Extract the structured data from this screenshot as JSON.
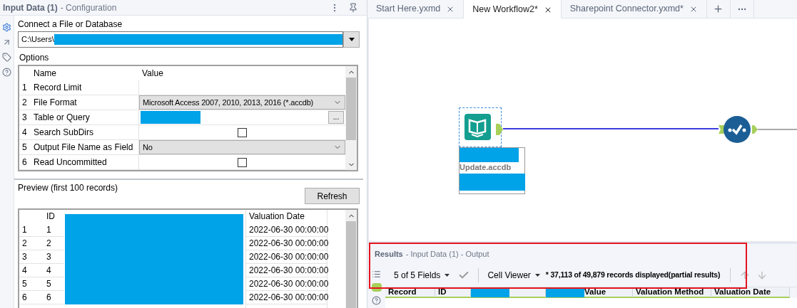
{
  "config_panel": {
    "title": "Input Data (1)",
    "subtitle": "- Configuration",
    "connect_label": "Connect a File or Database",
    "path_value": "C:\\Users\\",
    "options_label": "Options"
  },
  "options_table": {
    "columns": [
      "Name",
      "Value"
    ],
    "rows": [
      {
        "num": "1",
        "name": "Record Limit",
        "kind": "text"
      },
      {
        "num": "2",
        "name": "File Format",
        "kind": "dropdown",
        "value": "Microsoft Access 2007, 2010, 2013, 2016 (*.accdb)"
      },
      {
        "num": "3",
        "name": "Table or Query",
        "kind": "browse",
        "browse_label": "..."
      },
      {
        "num": "4",
        "name": "Search SubDirs",
        "kind": "checkbox",
        "checked": false
      },
      {
        "num": "5",
        "name": "Output File Name as Field",
        "kind": "dropdown",
        "value": "No"
      },
      {
        "num": "6",
        "name": "Read Uncommitted",
        "kind": "checkbox",
        "checked": false
      }
    ]
  },
  "preview": {
    "label": "Preview (first 100 records)",
    "refresh_button": "Refresh",
    "columns": [
      "ID",
      "Valuation Date"
    ],
    "rows": [
      {
        "num": "1",
        "id": "1",
        "date": "2022-06-30 00:00:00"
      },
      {
        "num": "2",
        "id": "2",
        "date": "2022-06-30 00:00:00"
      },
      {
        "num": "3",
        "id": "3",
        "date": "2022-06-30 00:00:00"
      },
      {
        "num": "4",
        "id": "4",
        "date": "2022-06-30 00:00:00"
      },
      {
        "num": "5",
        "id": "5",
        "date": "2022-06-30 00:00:00"
      },
      {
        "num": "6",
        "id": "6",
        "date": "2022-06-30 00:00:00"
      }
    ]
  },
  "tabs": [
    {
      "label": "Start Here.yxmd",
      "selected": false
    },
    {
      "label": "New Workflow2*",
      "selected": true
    },
    {
      "label": "Sharepoint Connector.yxmd*",
      "selected": false
    }
  ],
  "canvas": {
    "node_label": "Update.accdb"
  },
  "results": {
    "title": "Results",
    "subtitle": "- Input Data (1) - Output",
    "fields_dropdown": "5 of 5 Fields",
    "viewer_dropdown": "Cell Viewer",
    "records_info": "* 37,113 of 49,879 records displayed(partial results)",
    "columns": [
      {
        "label": "Record",
        "redacted": false
      },
      {
        "label": "ID",
        "redacted": false
      },
      {
        "redacted": true
      },
      {
        "label": "Value",
        "redacted": true
      },
      {
        "label": "Valuation Method",
        "redacted": false
      },
      {
        "label": "Valuation Date",
        "redacted": false
      }
    ]
  }
}
